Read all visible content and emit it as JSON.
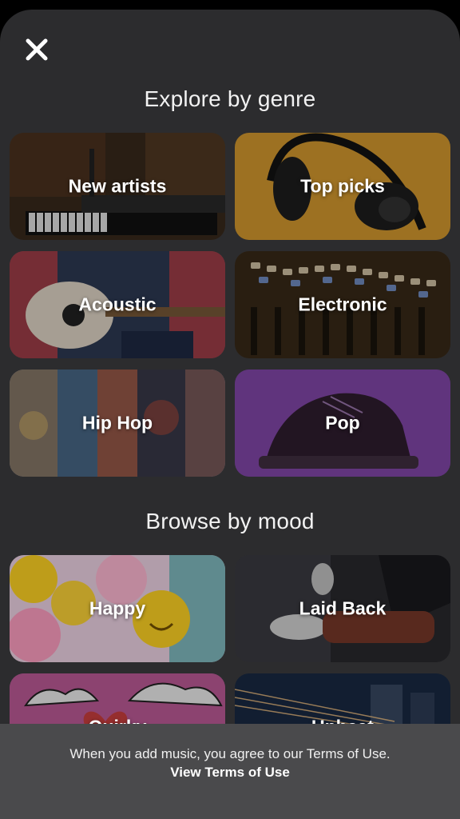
{
  "close_icon": "close-icon",
  "genre": {
    "title": "Explore by genre",
    "tiles": [
      {
        "label": "New artists"
      },
      {
        "label": "Top picks"
      },
      {
        "label": "Acoustic"
      },
      {
        "label": "Electronic"
      },
      {
        "label": "Hip Hop"
      },
      {
        "label": "Pop"
      }
    ]
  },
  "mood": {
    "title": "Browse by mood",
    "tiles": [
      {
        "label": "Happy"
      },
      {
        "label": "Laid Back"
      },
      {
        "label": "Quirky"
      },
      {
        "label": "Upbeat"
      }
    ]
  },
  "footer": {
    "notice": "When you add music, you agree to our Terms of Use.",
    "link": "View Terms of Use"
  }
}
